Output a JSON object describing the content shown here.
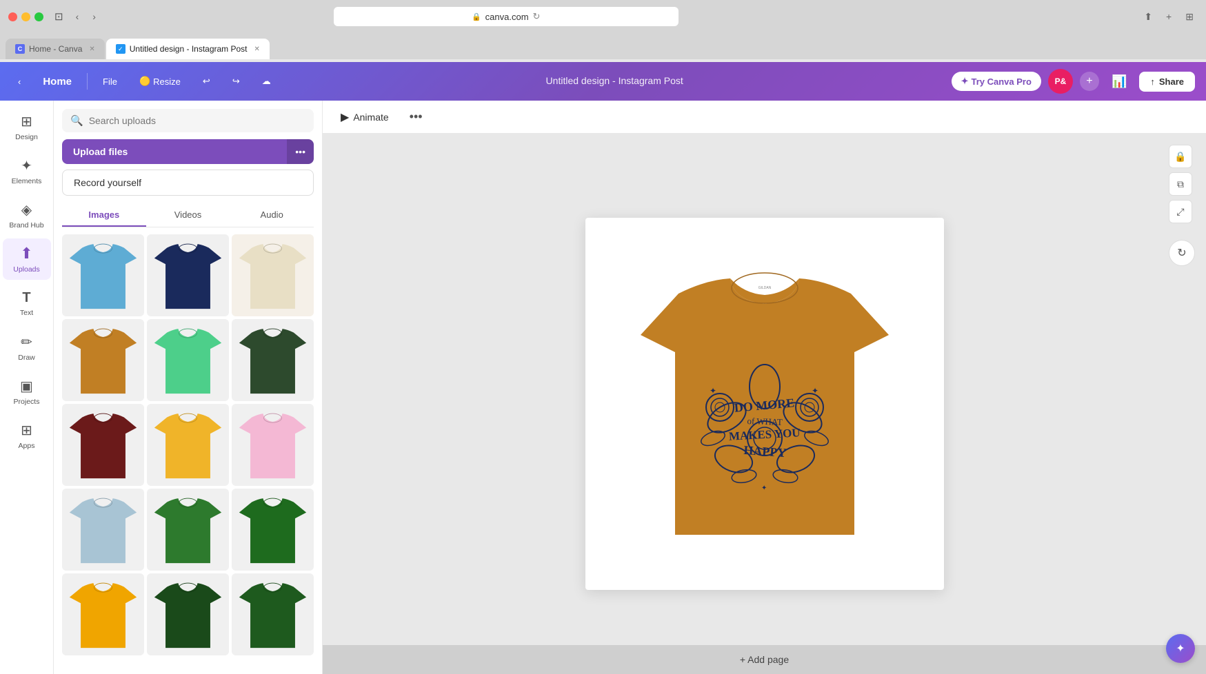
{
  "browser": {
    "address": "canva.com",
    "tabs": [
      {
        "label": "Home - Canva",
        "favicon_color": "#5b6cf0",
        "active": false
      },
      {
        "label": "Untitled design - Instagram Post",
        "favicon_color": "#2196F3",
        "active": true
      }
    ]
  },
  "toolbar": {
    "home_label": "Home",
    "file_label": "File",
    "resize_label": "Resize",
    "design_title": "Untitled design - Instagram Post",
    "try_pro_label": "Try Canva Pro",
    "share_label": "Share",
    "avatar_initials": "P&"
  },
  "sidebar": {
    "items": [
      {
        "id": "design",
        "label": "Design",
        "icon": "⊞"
      },
      {
        "id": "elements",
        "label": "Elements",
        "icon": "✦"
      },
      {
        "id": "brand-hub",
        "label": "Brand Hub",
        "icon": "◈"
      },
      {
        "id": "uploads",
        "label": "Uploads",
        "icon": "↑",
        "active": true
      },
      {
        "id": "text",
        "label": "Text",
        "icon": "T"
      },
      {
        "id": "draw",
        "label": "Draw",
        "icon": "✏"
      },
      {
        "id": "projects",
        "label": "Projects",
        "icon": "□"
      },
      {
        "id": "apps",
        "label": "Apps",
        "icon": "⊞"
      }
    ]
  },
  "upload_panel": {
    "search_placeholder": "Search uploads",
    "upload_button_label": "Upload files",
    "record_button_label": "Record yourself",
    "tabs": [
      {
        "id": "images",
        "label": "Images",
        "active": true
      },
      {
        "id": "videos",
        "label": "Videos",
        "active": false
      },
      {
        "id": "audio",
        "label": "Audio",
        "active": false
      }
    ]
  },
  "tshirts": [
    {
      "color": "#5eacd4",
      "label": "light blue"
    },
    {
      "color": "#1a2a5c",
      "label": "navy"
    },
    {
      "color": "#e8dfc5",
      "label": "tan"
    },
    {
      "color": "#c17f24",
      "label": "orange"
    },
    {
      "color": "#4dcf8a",
      "label": "mint"
    },
    {
      "color": "#2d4a2d",
      "label": "dark green"
    },
    {
      "color": "#6b1a1a",
      "label": "maroon"
    },
    {
      "color": "#f0b429",
      "label": "yellow"
    },
    {
      "color": "#f4b8d4",
      "label": "pink"
    },
    {
      "color": "#a8c4d4",
      "label": "light grey-blue"
    },
    {
      "color": "#2d7a2d",
      "label": "green"
    },
    {
      "color": "#1e6b1e",
      "label": "forest green"
    },
    {
      "color": "#f0a500",
      "label": "amber"
    },
    {
      "color": "#1a4a1a",
      "label": "dark forest"
    },
    {
      "color": "#1e5a1e",
      "label": "pine"
    }
  ],
  "canvas": {
    "tshirt_color": "#c17f24",
    "animate_label": "Animate",
    "add_page_label": "+ Add page"
  },
  "colors": {
    "primary": "#7c4dbb",
    "upload_btn": "#7c4dbb",
    "active_tab": "#7c4dbb"
  }
}
